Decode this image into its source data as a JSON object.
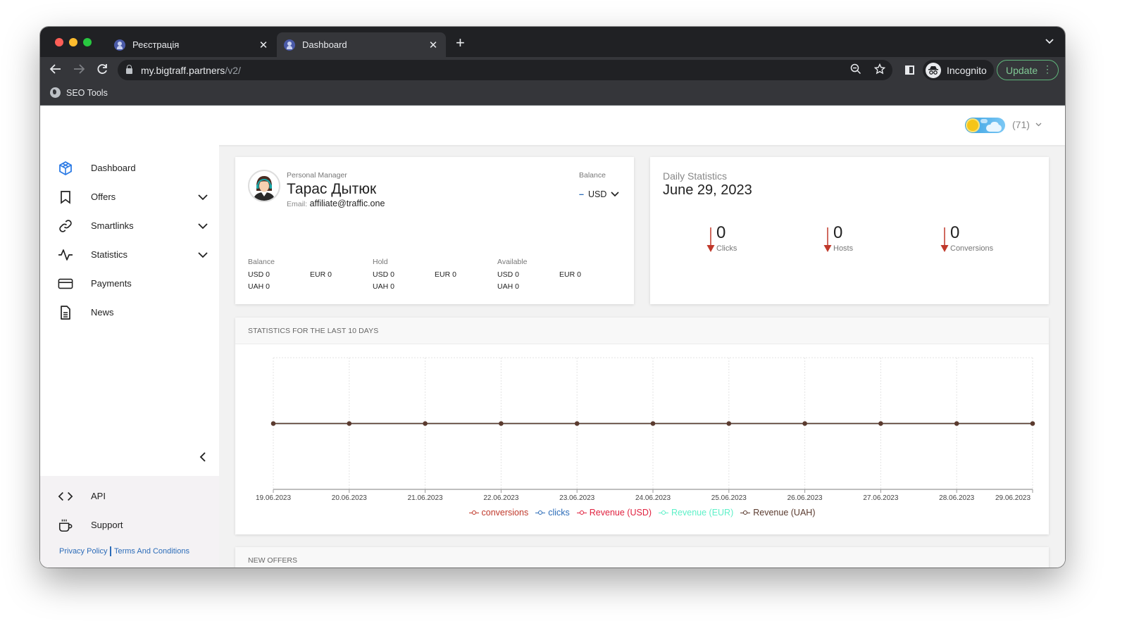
{
  "browser": {
    "tabs": [
      {
        "title": "Реєстрація",
        "active": false
      },
      {
        "title": "Dashboard",
        "active": true
      }
    ],
    "url_host": "my.bigtraff.partners",
    "url_path": "/v2/",
    "profile_label": "Incognito",
    "update_label": "Update",
    "bookmarks": [
      {
        "label": "SEO Tools"
      }
    ]
  },
  "header": {
    "notifications_count": "(71)",
    "theme": "light"
  },
  "sidebar": {
    "items": [
      {
        "label": "Dashboard",
        "icon": "cube-icon",
        "active": true,
        "expandable": false
      },
      {
        "label": "Offers",
        "icon": "bookmark-icon",
        "active": false,
        "expandable": true
      },
      {
        "label": "Smartlinks",
        "icon": "link-icon",
        "active": false,
        "expandable": true
      },
      {
        "label": "Statistics",
        "icon": "pulse-icon",
        "active": false,
        "expandable": true
      },
      {
        "label": "Payments",
        "icon": "credit-card-icon",
        "active": false,
        "expandable": false
      },
      {
        "label": "News",
        "icon": "document-icon",
        "active": false,
        "expandable": false
      }
    ],
    "bottom_items": [
      {
        "label": "API",
        "icon": "code-icon"
      },
      {
        "label": "Support",
        "icon": "coffee-cup-icon"
      }
    ],
    "footer_links": {
      "privacy": "Privacy Policy",
      "terms": "Terms And Conditions"
    }
  },
  "manager": {
    "label": "Personal Manager",
    "name": "Тарас Дытюк",
    "email_label": "Email:",
    "email": "affiliate@traffic.one",
    "balance_label": "Balance",
    "currency_selected": "USD",
    "currency_dash": "–"
  },
  "balances": [
    {
      "title": "Balance",
      "usd": "USD 0",
      "eur": "EUR 0",
      "uah": "UAH 0"
    },
    {
      "title": "Hold",
      "usd": "USD 0",
      "eur": "EUR 0",
      "uah": "UAH 0"
    },
    {
      "title": "Available",
      "usd": "USD 0",
      "eur": "EUR 0",
      "uah": "UAH 0"
    }
  ],
  "daily": {
    "label": "Daily Statistics",
    "date": "June 29, 2023",
    "stats": [
      {
        "value": "0",
        "label": "Clicks",
        "trend": "down"
      },
      {
        "value": "0",
        "label": "Hosts",
        "trend": "down"
      },
      {
        "value": "0",
        "label": "Conversions",
        "trend": "down"
      }
    ],
    "trend_color": "#c0392b"
  },
  "chart_section_title": "STATISTICS FOR THE LAST 10 DAYS",
  "chart_data": {
    "type": "line",
    "title": "STATISTICS FOR THE LAST 10 DAYS",
    "xlabel": "",
    "ylabel": "",
    "x": [
      "19.06.2023",
      "20.06.2023",
      "21.06.2023",
      "22.06.2023",
      "23.06.2023",
      "24.06.2023",
      "25.06.2023",
      "26.06.2023",
      "27.06.2023",
      "28.06.2023",
      "29.06.2023"
    ],
    "series": [
      {
        "name": "conversions",
        "color": "#c0392b",
        "values": [
          0,
          0,
          0,
          0,
          0,
          0,
          0,
          0,
          0,
          0,
          0
        ]
      },
      {
        "name": "clicks",
        "color": "#2c6cb8",
        "values": [
          0,
          0,
          0,
          0,
          0,
          0,
          0,
          0,
          0,
          0,
          0
        ]
      },
      {
        "name": "Revenue (USD)",
        "color": "#e0213f",
        "values": [
          0,
          0,
          0,
          0,
          0,
          0,
          0,
          0,
          0,
          0,
          0
        ]
      },
      {
        "name": "Revenue (EUR)",
        "color": "#5ef0c8",
        "values": [
          0,
          0,
          0,
          0,
          0,
          0,
          0,
          0,
          0,
          0,
          0
        ]
      },
      {
        "name": "Revenue (UAH)",
        "color": "#5a3a2e",
        "values": [
          0,
          0,
          0,
          0,
          0,
          0,
          0,
          0,
          0,
          0,
          0
        ]
      }
    ],
    "ylim": [
      -1,
      1
    ],
    "grid": true,
    "legend": "bottom-center"
  },
  "new_offers_title": "NEW OFFERS"
}
